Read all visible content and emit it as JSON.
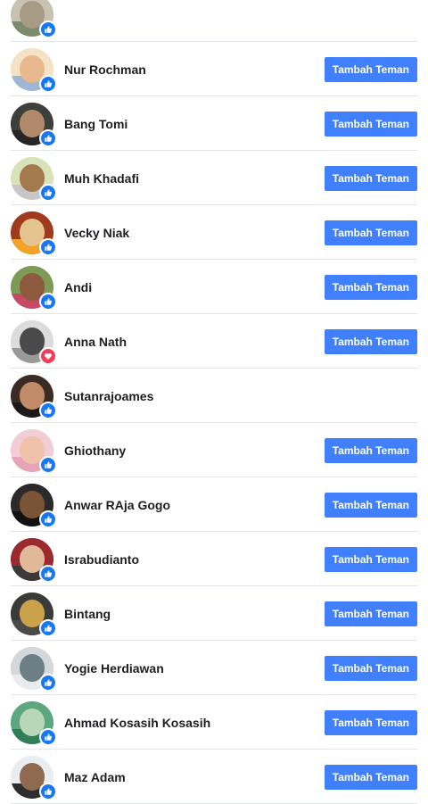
{
  "add_label": "Tambah Teman",
  "reaction_icons": {
    "like": {
      "name": "like-icon",
      "color": "#1877f2"
    },
    "love": {
      "name": "love-icon",
      "color": "#f33e58"
    }
  },
  "people": [
    {
      "name": "",
      "reaction": "like",
      "show_add": false,
      "colors": [
        "#c9c2b3",
        "#a89b86",
        "#7c8a6e"
      ]
    },
    {
      "name": "Nur Rochman",
      "reaction": "like",
      "show_add": true,
      "colors": [
        "#f4e2c7",
        "#e7b98c",
        "#9fb7d6"
      ]
    },
    {
      "name": "Bang Tomi",
      "reaction": "like",
      "show_add": true,
      "colors": [
        "#3c3f3a",
        "#b08a6b",
        "#262626"
      ]
    },
    {
      "name": "Muh Khadafi",
      "reaction": "like",
      "show_add": true,
      "colors": [
        "#d8e3b8",
        "#a5794e",
        "#c7c7c7"
      ]
    },
    {
      "name": "Vecky Niak",
      "reaction": "like",
      "show_add": true,
      "colors": [
        "#a03a1d",
        "#e6c48f",
        "#f0a229"
      ]
    },
    {
      "name": "Andi",
      "reaction": "like",
      "show_add": true,
      "colors": [
        "#7d9a57",
        "#8d5a3d",
        "#c64a63"
      ]
    },
    {
      "name": "Anna Nath",
      "reaction": "love",
      "show_add": true,
      "colors": [
        "#dcdcdc",
        "#4a4a4a",
        "#9a9a9a"
      ]
    },
    {
      "name": "Sutanrajoames",
      "reaction": "like",
      "show_add": false,
      "colors": [
        "#3b2b25",
        "#c28b6a",
        "#1c1a18"
      ]
    },
    {
      "name": "Ghiothany",
      "reaction": "like",
      "show_add": true,
      "colors": [
        "#f3cdd5",
        "#efc2a9",
        "#e6a4b8"
      ]
    },
    {
      "name": "Anwar RAja Gogo",
      "reaction": "like",
      "show_add": true,
      "colors": [
        "#2a2a2a",
        "#7a5436",
        "#111111"
      ]
    },
    {
      "name": "Israbudianto",
      "reaction": "like",
      "show_add": true,
      "colors": [
        "#9b2a2e",
        "#e2b998",
        "#3a3a3a"
      ]
    },
    {
      "name": "Bintang",
      "reaction": "like",
      "show_add": true,
      "colors": [
        "#3a3a3a",
        "#c9a24a",
        "#4a4a4a"
      ]
    },
    {
      "name": "Yogie Herdiawan",
      "reaction": "like",
      "show_add": true,
      "colors": [
        "#d3d8dc",
        "#6e7e86",
        "#e9ecee"
      ]
    },
    {
      "name": "Ahmad Kosasih Kosasih",
      "reaction": "like",
      "show_add": true,
      "colors": [
        "#5ca77f",
        "#b7d7b8",
        "#2f7e58"
      ]
    },
    {
      "name": "Maz Adam",
      "reaction": "like",
      "show_add": true,
      "colors": [
        "#e9edf0",
        "#8f6a4f",
        "#2d2d2d"
      ]
    }
  ]
}
